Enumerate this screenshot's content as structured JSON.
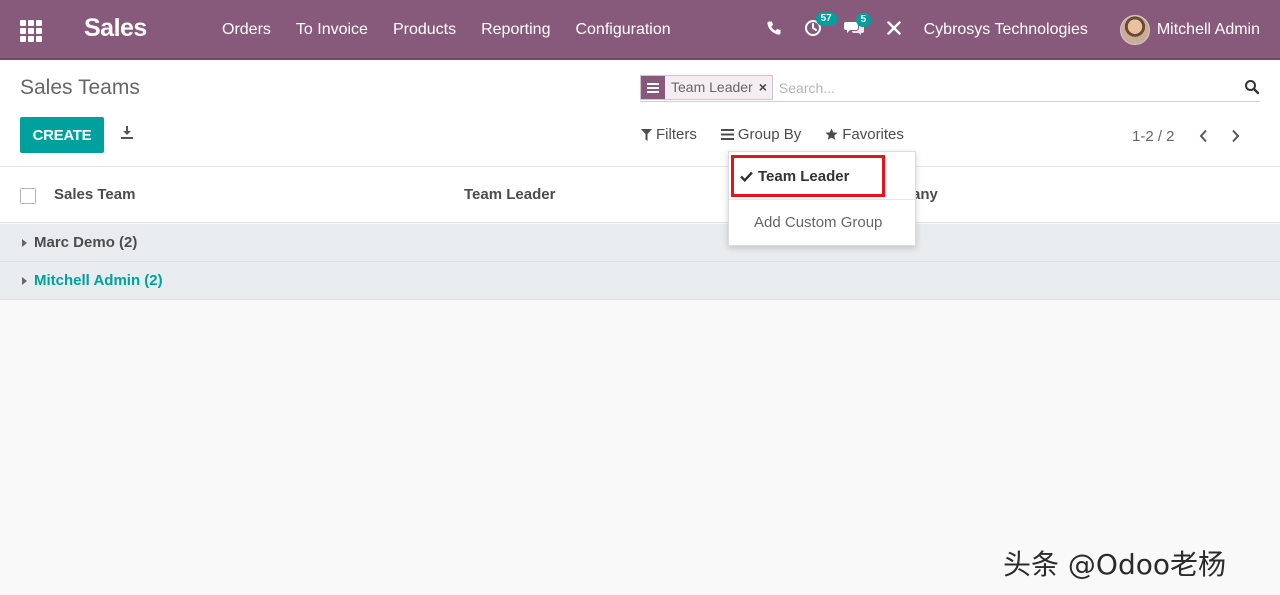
{
  "navbar": {
    "brand": "Sales",
    "menu": [
      "Orders",
      "To Invoice",
      "Products",
      "Reporting",
      "Configuration"
    ],
    "activity_count": "57",
    "messages_count": "5",
    "company": "Cybrosys Technologies",
    "user": "Mitchell Admin"
  },
  "control_panel": {
    "breadcrumb": "Sales Teams",
    "search": {
      "facet_value": "Team Leader",
      "facet_remove": "×",
      "placeholder": "Search..."
    },
    "create_label": "CREATE",
    "filters_label": "Filters",
    "group_by_label": "Group By",
    "favorites_label": "Favorites",
    "pager_value": "1-2 / 2"
  },
  "group_by_dropdown": {
    "checked_item": "Team Leader",
    "add_custom": "Add Custom Group"
  },
  "list": {
    "columns": [
      "Sales Team",
      "Team Leader",
      "any"
    ],
    "groups": [
      {
        "label": "Marc Demo (2)",
        "color": "#4c4c4c"
      },
      {
        "label": "Mitchell Admin (2)",
        "color": "#00a09d"
      }
    ]
  },
  "colors": {
    "brand": "#875a7b",
    "accent": "#00a09d",
    "highlight": "#e3141f"
  },
  "watermark": "头条 @Odoo老杨"
}
